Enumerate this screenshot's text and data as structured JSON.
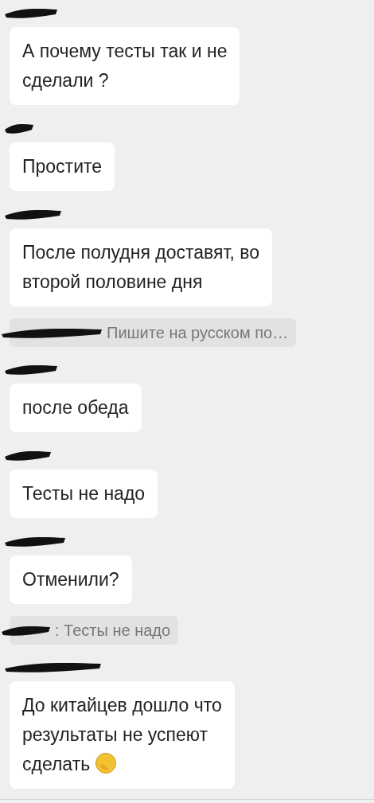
{
  "messages": [
    {
      "kind": "message",
      "lines": [
        "А почему тесты так и не",
        "сделали ?"
      ]
    },
    {
      "kind": "message",
      "lines": [
        "Простите"
      ]
    },
    {
      "kind": "message",
      "lines": [
        "После полудня доставят, во",
        "второй половине дня"
      ]
    },
    {
      "kind": "quote",
      "text": "Пишите на русском по…"
    },
    {
      "kind": "message",
      "lines": [
        "после обеда"
      ]
    },
    {
      "kind": "message",
      "lines": [
        "Тесты не надо"
      ]
    },
    {
      "kind": "message",
      "lines": [
        "Отменили?"
      ]
    },
    {
      "kind": "quote",
      "text": ": Тесты не надо"
    },
    {
      "kind": "message",
      "lines": [
        "До китайцев дошло что",
        "результаты не успеют",
        "сделать"
      ],
      "emoji": true
    }
  ]
}
